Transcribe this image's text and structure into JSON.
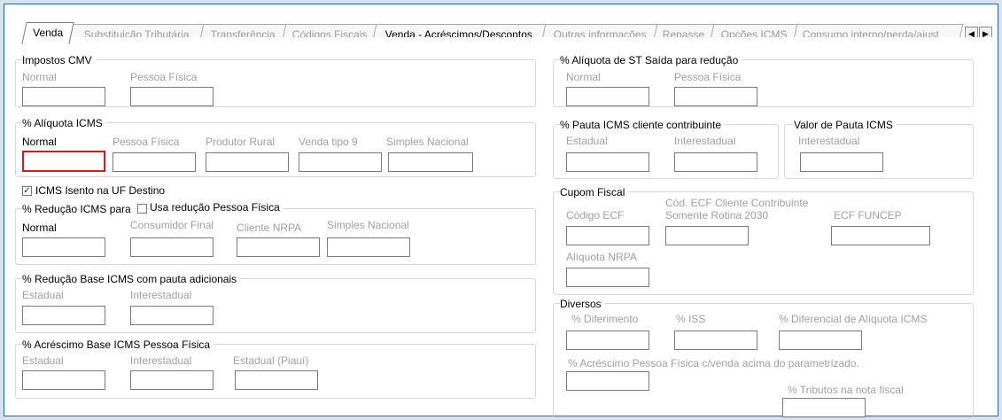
{
  "tabs": [
    {
      "label": "Venda",
      "active": true
    },
    {
      "label": "Substituição Tributária"
    },
    {
      "label": "Transferência"
    },
    {
      "label": "Códigos Fiscais"
    },
    {
      "label": "Venda - Acréscimos/Descontos"
    },
    {
      "label": "Outras informações"
    },
    {
      "label": "Repasse"
    },
    {
      "label": "Opções ICMS"
    },
    {
      "label": "Consumo interno/perda/ajust"
    }
  ],
  "tab_scroll": {
    "left": "◀",
    "right": "▶"
  },
  "left": {
    "impostos_cmv": {
      "title": "Impostos CMV",
      "normal": "Normal",
      "pessoa_fisica": "Pessoa Física"
    },
    "aliquota_icms": {
      "title": "% Alíquota ICMS",
      "normal": "Normal",
      "pessoa_fisica": "Pessoa Física",
      "produtor_rural": "Produtor Rural",
      "venda_tipo9": "Venda tipo 9",
      "simples_nacional": "Simples Nacional"
    },
    "icms_isento": {
      "label": "ICMS Isento na UF Destino",
      "check": "✓"
    },
    "reducao_icms": {
      "title": "% Redução ICMS para",
      "usa_reducao": "Usa redução Pessoa Física",
      "normal": "Normal",
      "consumidor_final": "Consumidor Final",
      "cliente_nrpa": "Cliente NRPA",
      "simples_nacional": "Simples Nacional"
    },
    "reducao_base": {
      "title": "% Redução Base ICMS com pauta adicionais",
      "estadual": "Estadual",
      "interestadual": "Interestadual"
    },
    "acrescimo_base": {
      "title": "% Acréscimo Base ICMS Pessoa Física",
      "estadual": "Estadual",
      "interestadual": "Interestadual",
      "estadual_piaui": "Estadual (Piauí)"
    }
  },
  "right": {
    "aliquota_st": {
      "title": "% Alíquota de ST Saída para redução",
      "normal": "Normal",
      "pessoa_fisica": "Pessoa Física"
    },
    "pauta_icms": {
      "title": "% Pauta ICMS cliente contribuinte",
      "estadual": "Estadual",
      "interestadual": "Interestadual"
    },
    "valor_pauta": {
      "title": "Valor de Pauta ICMS",
      "interestadual": "Interestadual"
    },
    "cupom_fiscal": {
      "title": "Cupom Fiscal",
      "codigo_ecf": "Código ECF",
      "cod_ecf_cliente_1": "Cód. ECF Cliente Contribuinte",
      "cod_ecf_cliente_2": "Somente Rotina 2030",
      "ecf_funcep": "ECF FUNCEP",
      "aliquota_nrpa": "Alíquota NRPA"
    },
    "diversos": {
      "title": "Diversos",
      "diferimento": "% Diferimento",
      "iss": "% ISS",
      "diferencial": "% Diferencial de Alíquota ICMS",
      "acrescimo_pf": "% Acréscimo Pessoa Física c/venda acima do parametrizado.",
      "tributos": "% Tributos na nota fiscal"
    }
  }
}
